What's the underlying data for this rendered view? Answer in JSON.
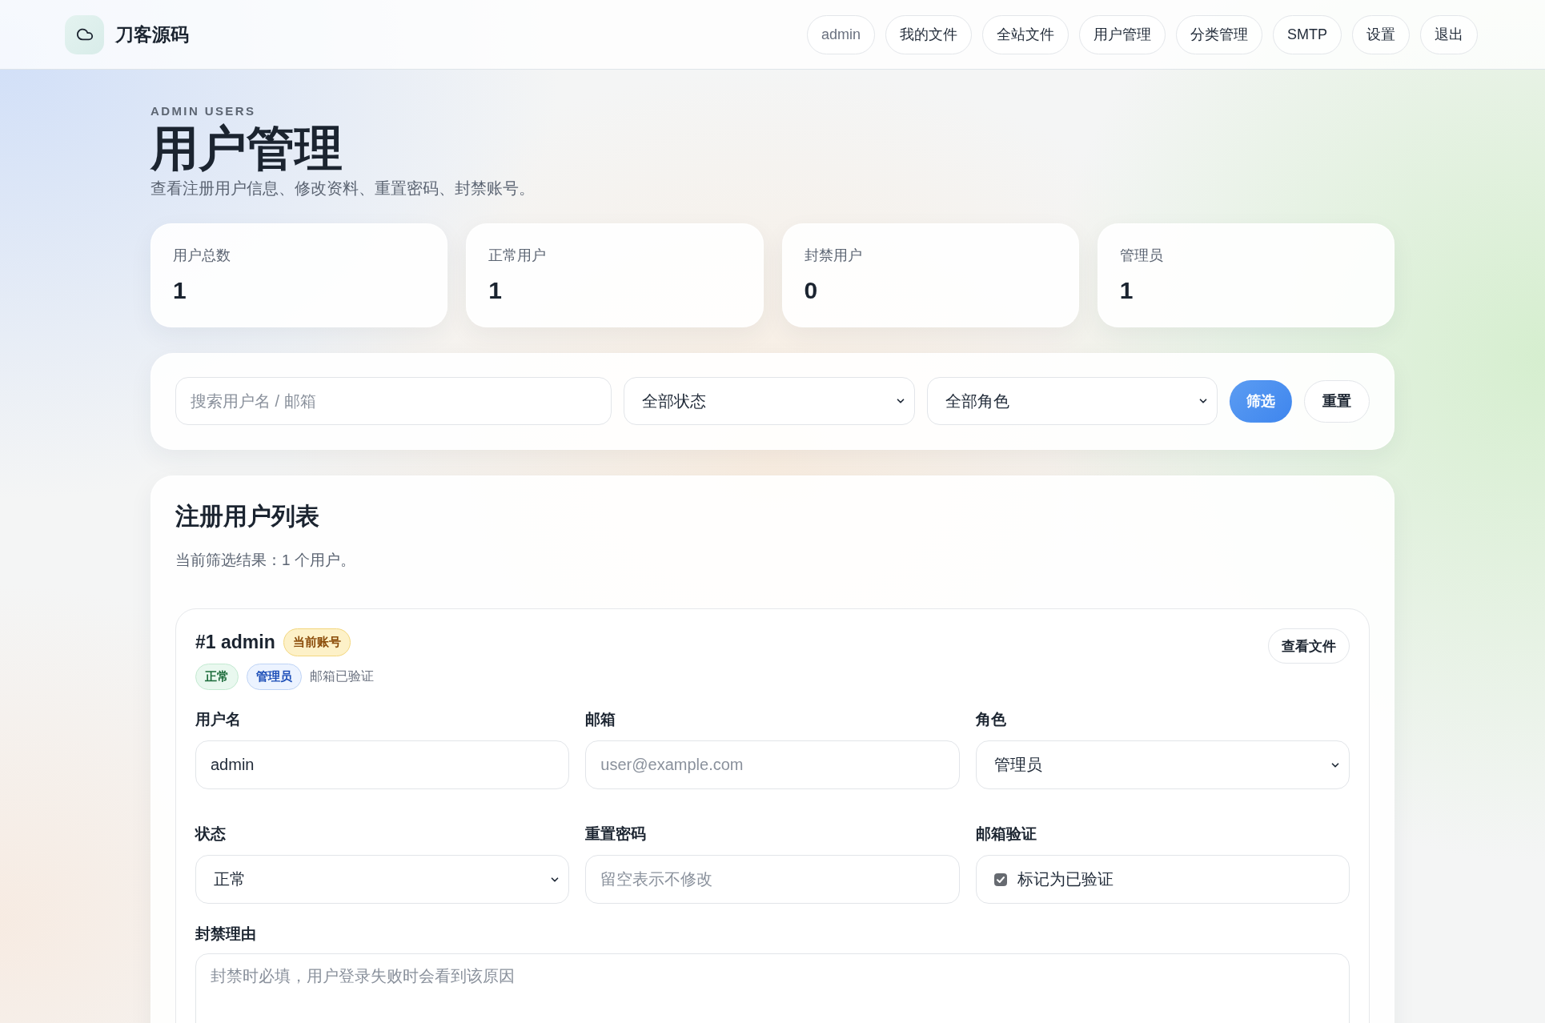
{
  "header": {
    "brand": "刀客源码",
    "nav": [
      {
        "label": "admin",
        "kind": "user"
      },
      {
        "label": "我的文件",
        "kind": "link"
      },
      {
        "label": "全站文件",
        "kind": "link"
      },
      {
        "label": "用户管理",
        "kind": "link"
      },
      {
        "label": "分类管理",
        "kind": "link"
      },
      {
        "label": "SMTP",
        "kind": "link"
      },
      {
        "label": "设置",
        "kind": "link"
      },
      {
        "label": "退出",
        "kind": "link"
      }
    ]
  },
  "hero": {
    "eyebrow": "ADMIN USERS",
    "title": "用户管理",
    "subtitle": "查看注册用户信息、修改资料、重置密码、封禁账号。"
  },
  "stats": [
    {
      "label": "用户总数",
      "value": "1"
    },
    {
      "label": "正常用户",
      "value": "1"
    },
    {
      "label": "封禁用户",
      "value": "0"
    },
    {
      "label": "管理员",
      "value": "1"
    }
  ],
  "filters": {
    "search": {
      "placeholder": "搜索用户名 / 邮箱"
    },
    "status_filter": {
      "value": "全部状态"
    },
    "role_filter": {
      "value": "全部角色"
    },
    "buttons": [
      {
        "label": "筛选",
        "kind": "primary"
      },
      {
        "label": "重置",
        "kind": "secondary"
      }
    ]
  },
  "user_list": {
    "title": "注册用户列表",
    "summary": "当前筛选结果：1 个用户。",
    "users": [
      {
        "heading": "#1 admin",
        "current_badge": "当前账号",
        "tags": [
          {
            "label": "正常",
            "kind": "success"
          },
          {
            "label": "管理员",
            "kind": "info"
          },
          {
            "label": "邮箱已验证",
            "kind": "plain"
          }
        ],
        "action": "查看文件",
        "fields": [
          {
            "kind": "input",
            "label": "用户名",
            "value": "admin"
          },
          {
            "kind": "input",
            "label": "邮箱",
            "placeholder": "user@example.com"
          },
          {
            "kind": "select",
            "label": "角色",
            "value": "管理员"
          },
          {
            "kind": "select",
            "label": "状态",
            "value": "正常"
          },
          {
            "kind": "input",
            "label": "重置密码",
            "placeholder": "留空表示不修改"
          },
          {
            "kind": "checkbox",
            "label": "邮箱验证",
            "text": "标记为已验证",
            "checked": true
          }
        ],
        "reason": {
          "label": "封禁理由",
          "placeholder": "封禁时必填，用户登录失败时会看到该原因"
        }
      }
    ]
  }
}
